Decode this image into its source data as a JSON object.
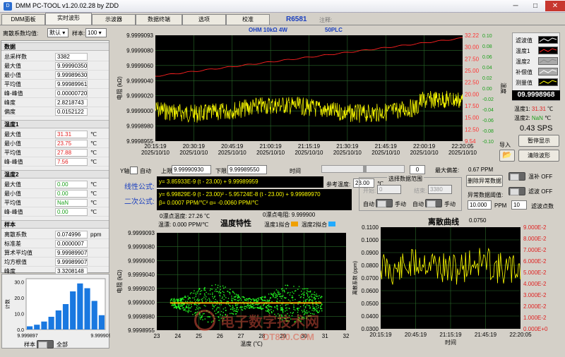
{
  "app": {
    "title": "DMM PC-TOOL v1.20.02.28 by ZDD",
    "device": "R6581",
    "note_label": "注释:"
  },
  "tabs": [
    "DMM面板",
    "实时波形",
    "示波器",
    "数据终端",
    "选项",
    "校准"
  ],
  "colors": {
    "plot_bg": "#000000",
    "grid": "#2a6a2a",
    "trace_yellow": "#ffff00",
    "trace_red": "#ff2020",
    "temp_axis": "#ff3333",
    "points": "#22ff22",
    "fit": "#ffaa00"
  },
  "top_controls": {
    "discrete_label": "离散系数均值:",
    "discrete_select": "默认",
    "samples_label": "样本:",
    "samples_select": "100"
  },
  "stats": {
    "data": {
      "title": "数据",
      "rows": [
        {
          "k": "总采样数",
          "v": "3382",
          "u": "",
          "c": ""
        },
        {
          "k": "最大值",
          "v": "9.99990350",
          "u": "",
          "c": ""
        },
        {
          "k": "最小值",
          "v": "9.99989630",
          "u": "",
          "c": ""
        },
        {
          "k": "平均值",
          "v": "9.99989961",
          "u": "",
          "c": ""
        },
        {
          "k": "峰-峰值",
          "v": "0.00000720",
          "u": "",
          "c": ""
        },
        {
          "k": "峰度",
          "v": "2.8218743",
          "u": "",
          "c": ""
        },
        {
          "k": "偏度",
          "v": "0.0152122",
          "u": "",
          "c": ""
        }
      ]
    },
    "temp1": {
      "title": "温度1",
      "rows": [
        {
          "k": "最大值",
          "v": "31.31",
          "u": "℃",
          "c": "red"
        },
        {
          "k": "最小值",
          "v": "23.75",
          "u": "℃",
          "c": "red"
        },
        {
          "k": "平均值",
          "v": "27.88",
          "u": "℃",
          "c": "red"
        },
        {
          "k": "峰-峰值",
          "v": "7.56",
          "u": "℃",
          "c": "red"
        }
      ]
    },
    "temp2": {
      "title": "温度2",
      "rows": [
        {
          "k": "最大值",
          "v": "0.00",
          "u": "℃",
          "c": "green"
        },
        {
          "k": "最小值",
          "v": "0.00",
          "u": "℃",
          "c": "green"
        },
        {
          "k": "平均值",
          "v": "NaN",
          "u": "℃",
          "c": "green"
        },
        {
          "k": "峰-峰值",
          "v": "0.00",
          "u": "℃",
          "c": "green"
        }
      ]
    },
    "sample": {
      "title": "样本",
      "rows": [
        {
          "k": "离散系数",
          "v": "0.074996",
          "u": "ppm",
          "c": ""
        },
        {
          "k": "标准差",
          "v": "0.0000007",
          "u": "",
          "c": ""
        },
        {
          "k": "算术平均值",
          "v": "9.99989907",
          "u": "",
          "c": ""
        },
        {
          "k": "均方根值",
          "v": "9.99989907",
          "u": "",
          "c": ""
        },
        {
          "k": "峰度",
          "v": "3.3208148",
          "u": "",
          "c": ""
        },
        {
          "k": "偏度",
          "v": "-0.3076240",
          "u": "",
          "c": ""
        }
      ]
    }
  },
  "hist": {
    "ylabel": "计数",
    "ticks": [
      "0.0",
      "10.0",
      "20.0",
      "30.0"
    ],
    "xleft": "9.999897",
    "xright": "9.999909",
    "mode_left": "样本",
    "mode_right": "全部",
    "bars": [
      2,
      3,
      5,
      8,
      12,
      16,
      24,
      29,
      26,
      18,
      9
    ]
  },
  "main_chart": {
    "header_left": "OHM  10kΩ 4W",
    "header_right": "50PLC",
    "ylabel": "电阻 (kΩ)",
    "y2label": "温度",
    "yticks": [
      "9.9999093",
      "9.9999080",
      "9.9999060",
      "9.9999040",
      "9.9999020",
      "9.9999000",
      "9.9998980",
      "9.9998955"
    ],
    "tticks": [
      "32.22",
      "30.00",
      "27.50",
      "25.00",
      "22.50",
      "20.00",
      "17.50",
      "15.00",
      "12.50",
      "9.54"
    ],
    "rticks": [
      "0.10",
      "0.08",
      "0.06",
      "0.04",
      "0.02",
      "0.00",
      "-0.02",
      "-0.04",
      "-0.06",
      "-0.08",
      "-0.10"
    ],
    "xticks": [
      [
        "20:15:19",
        "2025/10/10"
      ],
      [
        "20:30:19",
        "2025/10/10"
      ],
      [
        "20:45:19",
        "2025/10/10"
      ],
      [
        "21:00:19",
        "2025/10/10"
      ],
      [
        "21:15:19",
        "2025/10/10"
      ],
      [
        "21:30:19",
        "2025/10/10"
      ],
      [
        "21:45:19",
        "2025/10/10"
      ],
      [
        "22:00:19",
        "2025/10/10"
      ],
      [
        "22:20:05",
        "2025/10/10"
      ]
    ]
  },
  "legend": {
    "items": [
      "滤波值",
      "温度1",
      "温度2",
      "补偿值",
      "测量值"
    ],
    "colors": [
      "#ffffff",
      "#ff2020",
      "#888888",
      "#ffffff",
      "#ffff00"
    ],
    "reading": "09.9998968",
    "t1_label": "温度1:",
    "t1": "31.31",
    "t2_label": "温度2:",
    "t2": "NaN",
    "unit": "℃",
    "sps": "0.43 SPS",
    "pause": "暂停显示",
    "import": "导入",
    "clear": "清除波形"
  },
  "mid": {
    "yaxis": "Y轴",
    "auto": "自动",
    "upper_label": "上限",
    "upper": "9.99990930",
    "lower_label": "下限",
    "lower": "9.99989550",
    "time_label": "时间",
    "slider_val": "0",
    "max_dev_label": "最大偏差:",
    "max_dev": "0.67  PPM",
    "linear_label": "线性公式:",
    "linear": "y=  3.85933E-9 (t - 23.00) + 9.99989959",
    "quad_label": "二次公式:",
    "quad": "y=  6.99829E-9 (t - 23.00)² - 5.95724E-8 (t - 23.00) + 9.99989970",
    "beta": "β=     0.0007  PPM/℃²     α=  -0.0060  PPM/℃",
    "ref_temp_label": "参考温度:",
    "ref_temp": "23.00",
    "ref_unit": "℃",
    "range_title": "选择数据范围",
    "start_label": "开始:",
    "start": "0",
    "end_label": "结束:",
    "end": "3380",
    "auto1": "自动",
    "manual1": "手动",
    "auto2": "自动",
    "manual2": "手动",
    "del_btn": "删除异常数据",
    "threshold_label": "异常数据阈值:",
    "threshold": "10.000",
    "threshold_unit": "PPM",
    "filter_pts": "10",
    "filter_pts_label": "滤波点数",
    "temp_comp": "温补",
    "temp_comp_state": "OFF",
    "filter": "滤波",
    "filter_state": "OFF"
  },
  "temp_chart": {
    "title": "温度特性",
    "zero_temp_label": "0漂点温度:",
    "zero_temp": "27.26 ℃",
    "zero_res_label": "0漂点电阻:",
    "zero_res": "9.999900",
    "tc_label": "温漂:",
    "tc": "0.000  PPM/℃",
    "tc2_label": "温漂:",
    "tc2": "-0.0060  PPM/℃",
    "fit1": "温度1拟合",
    "fit2": "温度2拟合",
    "ylabel": "电阻 (kΩ)",
    "xlabel": "温度 (℃)",
    "yticks": [
      "9.9999093",
      "9.9999080",
      "9.9999060",
      "9.9999040",
      "9.9999020",
      "9.9999000",
      "9.9998980",
      "9.9998955"
    ],
    "xticks": [
      "23",
      "24",
      "25",
      "26",
      "27",
      "28",
      "29",
      "30",
      "31",
      "32"
    ]
  },
  "disc_chart": {
    "title": "离散曲线",
    "value": "0.0750",
    "ylabel": "离散系数 (ppm)",
    "xlabel": "时间",
    "yticks": [
      "0.1100",
      "0.1000",
      "0.0900",
      "0.0800",
      "0.0700",
      "0.0600",
      "0.0500",
      "0.0400",
      "0.0300"
    ],
    "rticks": [
      "9.000E-2",
      "8.000E-2",
      "7.000E-2",
      "6.000E-2",
      "5.000E-2",
      "4.000E-2",
      "3.000E-2",
      "2.000E-2",
      "1.000E-2",
      "0.000E+0"
    ],
    "xticks": [
      "20:15:19",
      "20:45:19",
      "21:15:19",
      "21:45:19",
      "22:20:05"
    ]
  },
  "watermark": {
    "text": "电子数字技术网",
    "sub": "DT830.COM"
  }
}
